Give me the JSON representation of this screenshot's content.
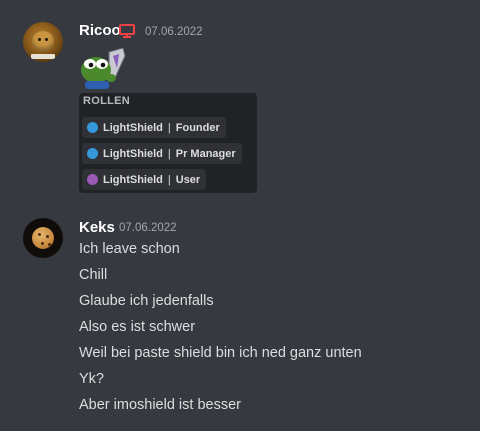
{
  "messages": [
    {
      "author": "Ricoo",
      "timestamp": "07.06.2022",
      "roles_card": {
        "title": "ROLLEN",
        "roles": [
          {
            "name": "LightShield",
            "role": "Founder",
            "color": "#3498db"
          },
          {
            "name": "LightShield",
            "role": "Pr Manager",
            "color": "#3498db"
          },
          {
            "name": "LightShield",
            "role": "User",
            "color": "#9b59b6"
          }
        ],
        "separator": "|"
      }
    },
    {
      "author": "Keks",
      "timestamp": "07.06.2022",
      "lines": [
        "Ich leave schon",
        "Chill",
        "Glaube ich jedenfalls",
        "Also es ist schwer",
        "Weil bei paste shield bin ich ned ganz unten",
        "Yk?",
        "Aber imoshield ist besser"
      ]
    }
  ],
  "icons": {
    "device": "monitor-icon",
    "sticker": "pepe-sticker"
  },
  "colors": {
    "background": "#36393f",
    "card": "#202225",
    "pill": "#2f3136",
    "monitor": "#ed4245"
  }
}
